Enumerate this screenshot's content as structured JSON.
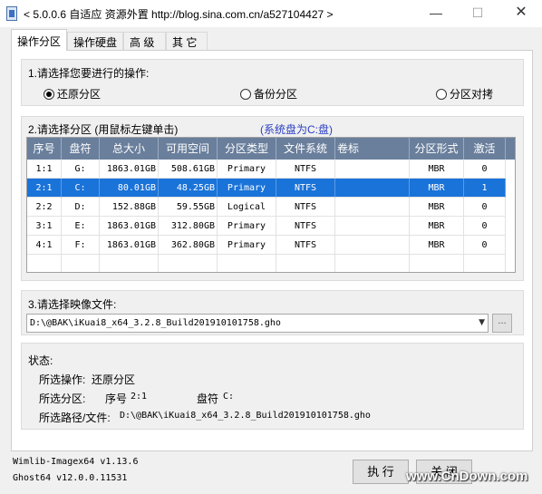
{
  "window": {
    "title": "< 5.0.0.6 自适应 资源外置 http://blog.sina.com.cn/a527104427 >",
    "minimize": "—",
    "maximize": "☐",
    "close": "✕"
  },
  "tabs": [
    {
      "label": "操作分区",
      "active": true
    },
    {
      "label": "操作硬盘",
      "active": false
    },
    {
      "label": "高 级",
      "active": false
    },
    {
      "label": "其 它",
      "active": false
    }
  ],
  "operation": {
    "label": "1.请选择您要进行的操作:",
    "options": [
      {
        "label": "还原分区",
        "checked": true
      },
      {
        "label": "备份分区",
        "checked": false
      },
      {
        "label": "分区对拷",
        "checked": false
      }
    ]
  },
  "partition": {
    "label": "2.请选择分区 (用鼠标左键单击)",
    "system_note": "(系统盘为C:盘)",
    "columns": [
      "序号",
      "盘符",
      "总大小",
      "可用空间",
      "分区类型",
      "文件系统",
      "卷标",
      "分区形式",
      "激活"
    ],
    "rows": [
      {
        "num": "1:1",
        "drive": "G:",
        "total": "1863.01GB",
        "free": "508.61GB",
        "type": "Primary",
        "fs": "NTFS",
        "label": "",
        "form": "MBR",
        "active": "0",
        "selected": false
      },
      {
        "num": "2:1",
        "drive": "C:",
        "total": "80.01GB",
        "free": "48.25GB",
        "type": "Primary",
        "fs": "NTFS",
        "label": "",
        "form": "MBR",
        "active": "1",
        "selected": true
      },
      {
        "num": "2:2",
        "drive": "D:",
        "total": "152.88GB",
        "free": "59.55GB",
        "type": "Logical",
        "fs": "NTFS",
        "label": "",
        "form": "MBR",
        "active": "0",
        "selected": false
      },
      {
        "num": "3:1",
        "drive": "E:",
        "total": "1863.01GB",
        "free": "312.80GB",
        "type": "Primary",
        "fs": "NTFS",
        "label": "",
        "form": "MBR",
        "active": "0",
        "selected": false
      },
      {
        "num": "4:1",
        "drive": "F:",
        "total": "1863.01GB",
        "free": "362.80GB",
        "type": "Primary",
        "fs": "NTFS",
        "label": "",
        "form": "MBR",
        "active": "0",
        "selected": false
      }
    ]
  },
  "image": {
    "label": "3.请选择映像文件:",
    "path": "D:\\@BAK\\iKuai8_x64_3.2.8_Build201910101758.gho",
    "browse": "...",
    "arrow": "▼"
  },
  "status": {
    "label": "状态:",
    "op_label": "所选操作:",
    "op_value": "还原分区",
    "part_label": "所选分区:",
    "part_num_label": "序号",
    "part_num": "2:1",
    "part_drive_label": "盘符",
    "part_drive": "C:",
    "path_label": "所选路径/文件:",
    "path_value": "D:\\@BAK\\iKuai8_x64_3.2.8_Build201910101758.gho"
  },
  "versions": {
    "wimlib": "Wimlib-Imagex64 v1.13.6",
    "ghost": "Ghost64 v12.0.0.11531"
  },
  "buttons": {
    "execute": "执 行",
    "close": "关 闭"
  },
  "watermark": "www.CnDown.com",
  "colors": {
    "selection": "#1a73d8",
    "header": "#6a7f9c",
    "system_note": "#2a3fc2"
  }
}
